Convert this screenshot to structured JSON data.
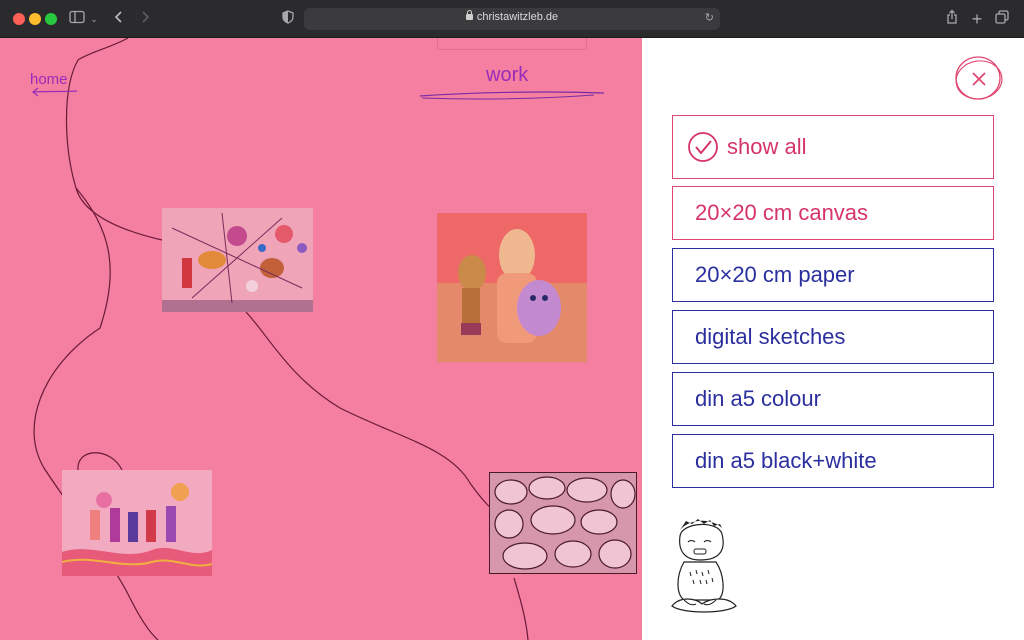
{
  "browser": {
    "url": "christawitzleb.de"
  },
  "page": {
    "home_label": "home",
    "work_label": "work"
  },
  "filters": [
    {
      "label": "show all",
      "active": true
    },
    {
      "label": "20×20 cm canvas",
      "active": false
    },
    {
      "label": "20×20 cm paper",
      "active": false
    },
    {
      "label": "digital sketches",
      "active": false
    },
    {
      "label": "din a5 colour",
      "active": false
    },
    {
      "label": "din a5 black+white",
      "active": false
    }
  ],
  "colors": {
    "canvas_pink": "#f47fa0",
    "accent_pink": "#d6336a",
    "filter_blue": "#2b2f9e",
    "link_purple": "#9a2db8"
  },
  "icons": {
    "close": "close-icon",
    "check": "check-circle-icon",
    "sidebar": "sidebar-icon",
    "back": "chevron-left-icon",
    "forward": "chevron-right-icon",
    "share": "share-icon",
    "new_tab": "plus-icon",
    "tabs": "tabs-overview-icon"
  }
}
